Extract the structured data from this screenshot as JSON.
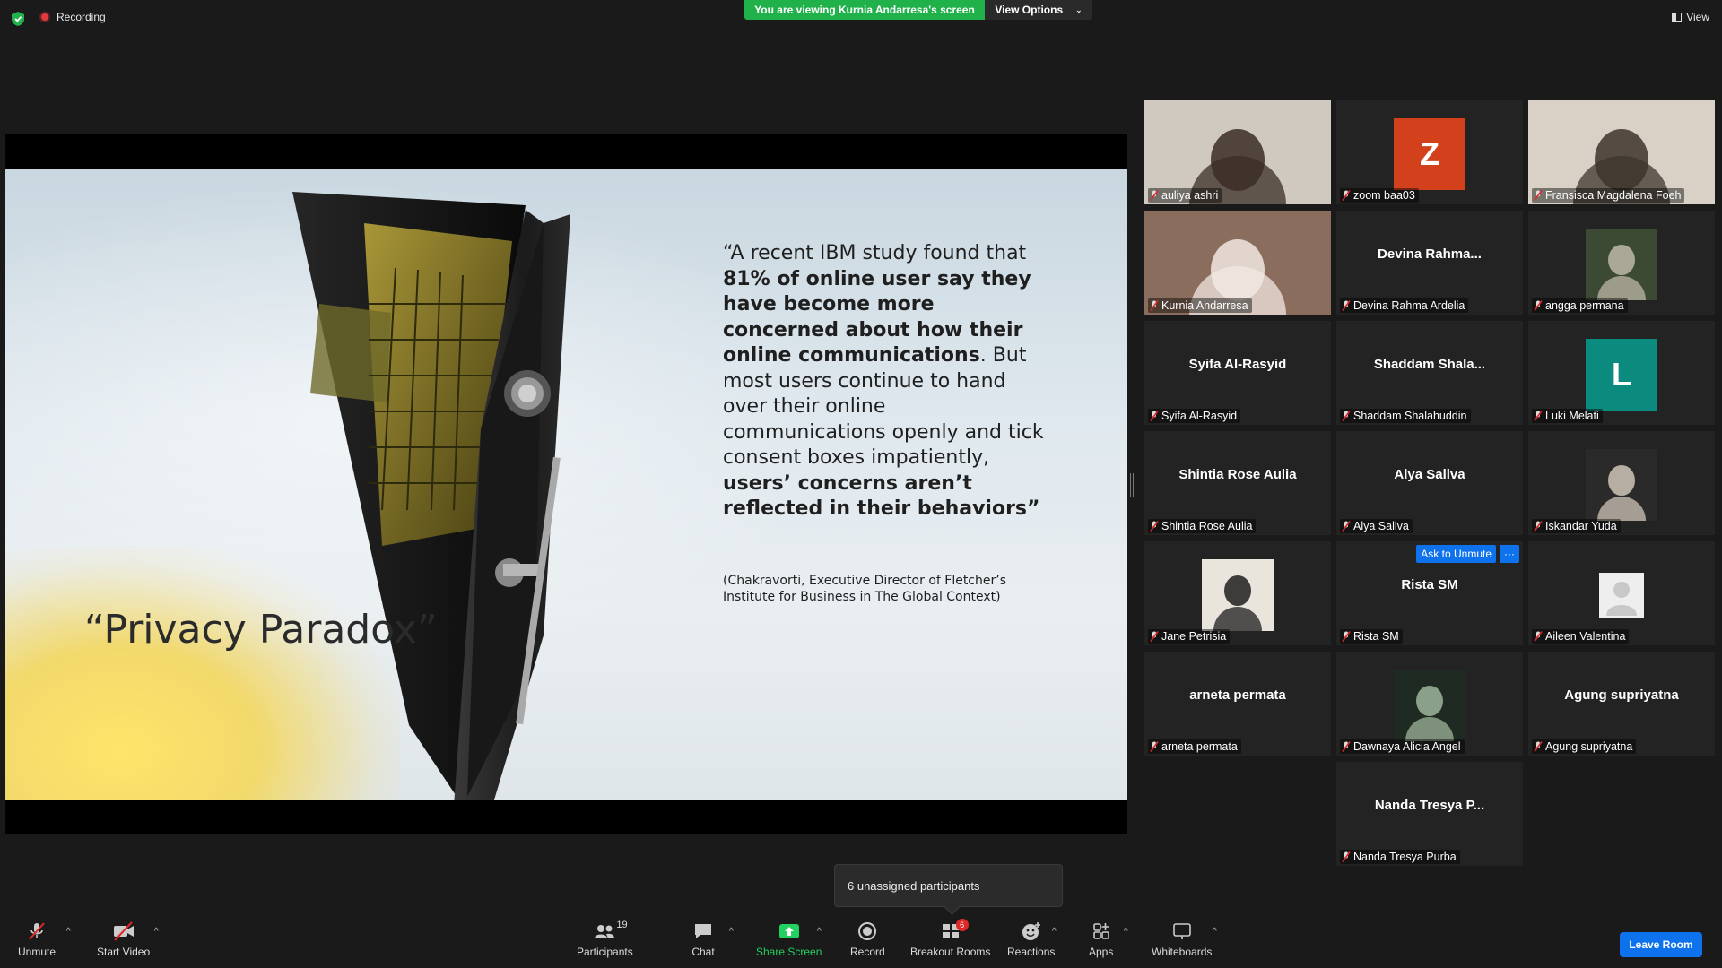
{
  "top": {
    "recording": "Recording",
    "viewing_banner": "You are viewing Kurnia Andarresa's screen",
    "view_options": "View Options",
    "view": "View"
  },
  "slide": {
    "quote_parts": [
      "“A recent IBM study found that ",
      "81% of online user say they have become more concerned about how their online communications",
      ". But most users continue to hand over their online communications openly and tick consent boxes impatiently, ",
      "users’ concerns aren’t reflected in their behaviors",
      "”"
    ],
    "citation": "(Chakravorti, Executive Director of Fletcher’s Institute for Business in The Global Context)",
    "title": "“Privacy Paradox”"
  },
  "participants": [
    {
      "label": "auliya ashri",
      "kind": "photo"
    },
    {
      "label": "zoom baa03",
      "kind": "avatar",
      "letter": "Z",
      "color": "#d2401c"
    },
    {
      "label": "Fransisca Magdalena Foeh",
      "kind": "photo"
    },
    {
      "label": "Kurnia Andarresa",
      "kind": "photo",
      "active": true
    },
    {
      "label": "Devina Rahma Ardelia",
      "kind": "name",
      "big": "Devina  Rahma..."
    },
    {
      "label": "angga permana",
      "kind": "photo"
    },
    {
      "label": "Syifa Al-Rasyid",
      "kind": "name",
      "big": "Syifa Al-Rasyid"
    },
    {
      "label": "Shaddam Shalahuddin",
      "kind": "name",
      "big": "Shaddam  Shala..."
    },
    {
      "label": "Luki Melati",
      "kind": "avatar",
      "letter": "L",
      "color": "#0b8a7e"
    },
    {
      "label": "Shintia Rose Aulia",
      "kind": "name",
      "big": "Shintia Rose Aulia"
    },
    {
      "label": "Alya Sallva",
      "kind": "name",
      "big": "Alya Sallva"
    },
    {
      "label": "Iskandar Yuda",
      "kind": "photo"
    },
    {
      "label": "Jane Petrisia",
      "kind": "photo"
    },
    {
      "label": "Rista SM",
      "kind": "name",
      "big": "Rista SM",
      "ask": "Ask to Unmute",
      "more": "···"
    },
    {
      "label": "Aileen Valentina",
      "kind": "default"
    },
    {
      "label": "arneta permata",
      "kind": "name",
      "big": "arneta permata"
    },
    {
      "label": "Dawnaya Alicia Angel",
      "kind": "photo"
    },
    {
      "label": "Agung supriyatna",
      "kind": "name",
      "big": "Agung supriyatna"
    },
    {
      "label": "Nanda Tresya Purba",
      "kind": "name",
      "big": "Nanda Tresya P..."
    }
  ],
  "tooltip": "6 unassigned participants",
  "toolbar": {
    "unmute": "Unmute",
    "start_video": "Start Video",
    "participants": "Participants",
    "participants_count": "19",
    "chat": "Chat",
    "share_screen": "Share Screen",
    "record": "Record",
    "breakout_rooms": "Breakout Rooms",
    "breakout_badge": "6",
    "reactions": "Reactions",
    "apps": "Apps",
    "whiteboards": "Whiteboards",
    "leave": "Leave Room"
  },
  "colors": {
    "accent": "#0e72ed",
    "share_green": "#21b14b",
    "active_border": "#f5e96a"
  }
}
